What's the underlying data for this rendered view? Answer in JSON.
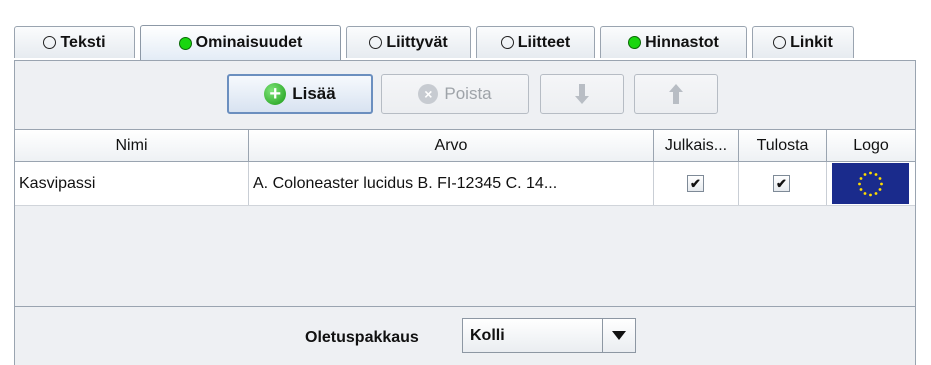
{
  "tabs": [
    {
      "label": "Teksti",
      "status": "empty"
    },
    {
      "label": "Ominaisuudet",
      "status": "green",
      "active": true
    },
    {
      "label": "Liittyvät",
      "status": "empty"
    },
    {
      "label": "Liitteet",
      "status": "empty"
    },
    {
      "label": "Hinnastot",
      "status": "green"
    },
    {
      "label": "Linkit",
      "status": "empty"
    }
  ],
  "toolbar": {
    "add_label": "Lisää",
    "remove_label": "Poista",
    "move_down_icon": "arrow-down-icon",
    "move_up_icon": "arrow-up-icon"
  },
  "table": {
    "columns": [
      "Nimi",
      "Arvo",
      "Julkais...",
      "Tulosta",
      "Logo"
    ],
    "rows": [
      {
        "name": "Kasvipassi",
        "value": "A. Coloneaster lucidus B. FI-12345 C. 14...",
        "publish": true,
        "print": true,
        "logo": "eu-flag-icon"
      }
    ]
  },
  "footer": {
    "label": "Oletuspakkaus",
    "select_value": "Kolli"
  },
  "colors": {
    "status_green": "#19d60f",
    "flag_blue": "#1a2b8c",
    "flag_stars": "#ffdd00"
  }
}
